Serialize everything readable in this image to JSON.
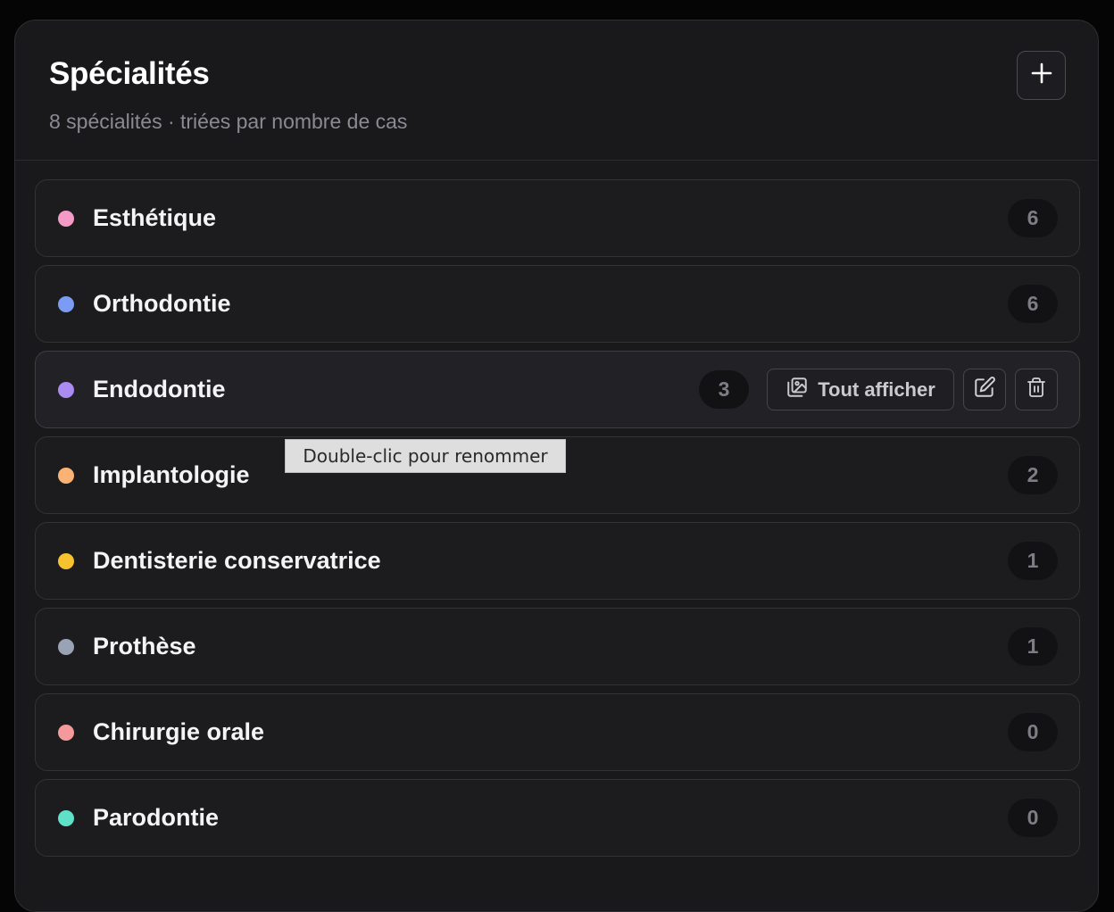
{
  "header": {
    "title": "Spécialités",
    "subtitle": "8 spécialités · triées par nombre de cas",
    "add_icon": "plus-icon"
  },
  "specialties": [
    {
      "name": "Esthétique",
      "count": "6",
      "color": "#f49ac7"
    },
    {
      "name": "Orthodontie",
      "count": "6",
      "color": "#7a9cf5"
    },
    {
      "name": "Endodontie",
      "count": "3",
      "color": "#a98bf2"
    },
    {
      "name": "Implantologie",
      "count": "2",
      "color": "#fbb275"
    },
    {
      "name": "Dentisterie conservatrice",
      "count": "1",
      "color": "#f7c12f"
    },
    {
      "name": "Prothèse",
      "count": "1",
      "color": "#9aa3b5"
    },
    {
      "name": "Chirurgie orale",
      "count": "0",
      "color": "#f59a9a"
    },
    {
      "name": "Parodontie",
      "count": "0",
      "color": "#5fe0c8"
    }
  ],
  "row_actions": {
    "show_all_label": "Tout afficher",
    "show_all_icon": "images-icon",
    "edit_icon": "edit-icon",
    "delete_icon": "trash-icon"
  },
  "tooltip": {
    "text": "Double-clic pour renommer"
  },
  "hovered_row_index": 2
}
